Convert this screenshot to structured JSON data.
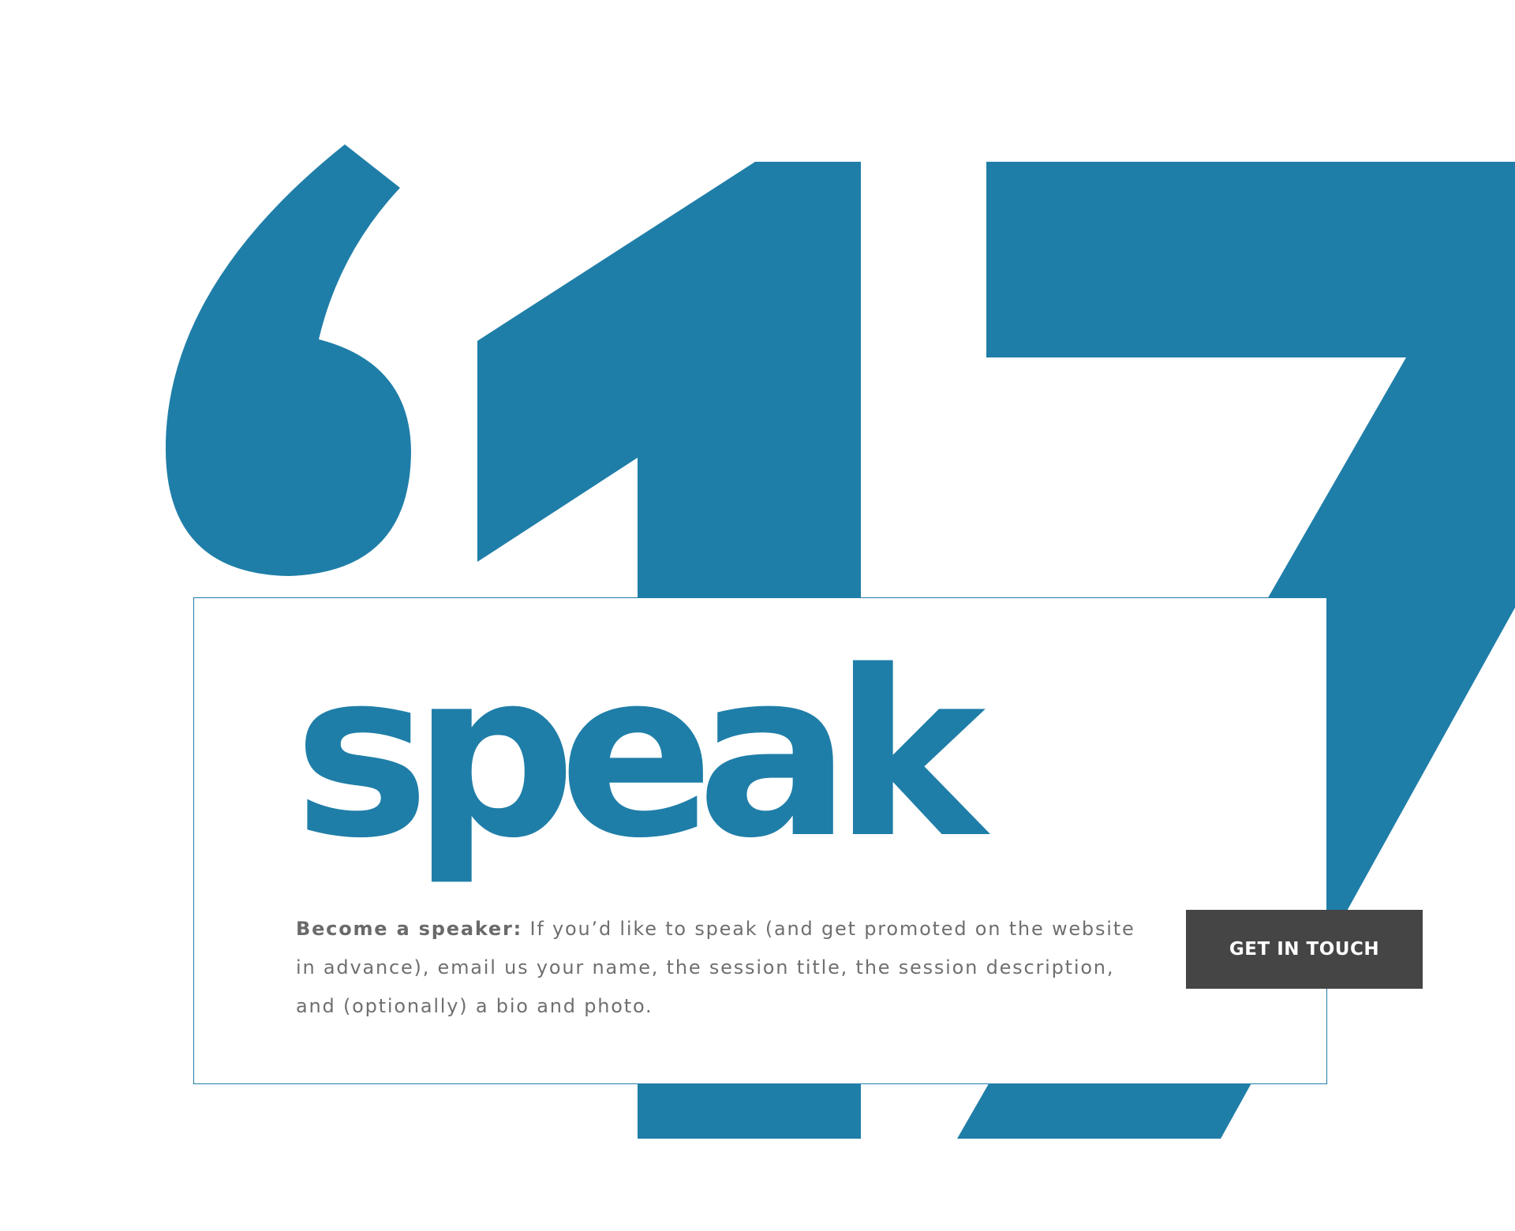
{
  "theme": {
    "accent": "#1f7ea8",
    "text_gray": "#6f6f6f",
    "button_bg": "#454545",
    "button_text": "#ffffff",
    "background": "#ffffff"
  },
  "background_graphic": {
    "icon": "quote-mark-icon",
    "number": "17"
  },
  "section": {
    "heading": "speak",
    "intro_label": "Become a speaker:",
    "intro_text": " If you’d like to speak (and get promoted on the website in advance), email us your name, the session title, the session description, and (optionally) a bio and photo.",
    "cta_label": "GET IN TOUCH"
  }
}
